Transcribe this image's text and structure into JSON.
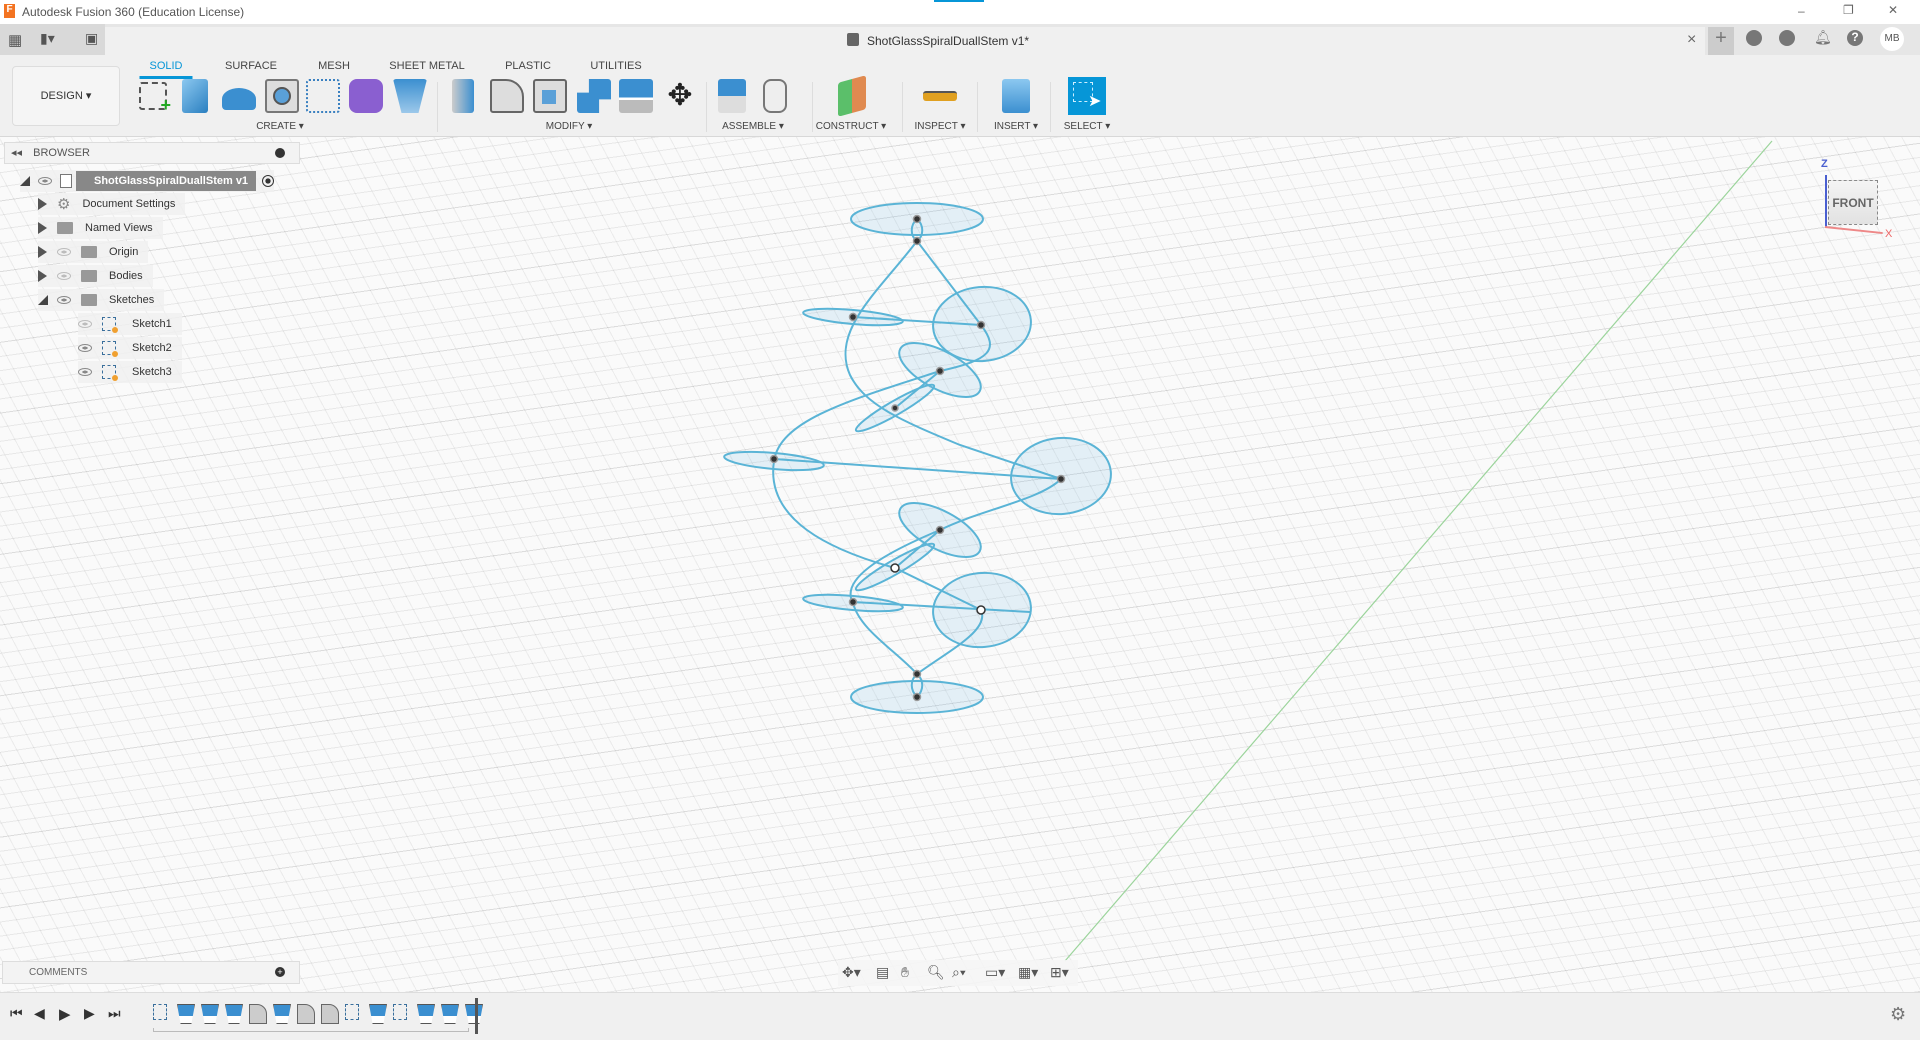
{
  "window": {
    "app_title": "Autodesk Fusion 360 (Education License)",
    "minimize": "–",
    "restore": "❐",
    "close": "✕"
  },
  "tabbar": {
    "document_title": "ShotGlassSpiralDuallStem v1*",
    "close": "×",
    "new_tab": "+",
    "user_initials": "MB"
  },
  "workspace": {
    "label": "DESIGN ▾"
  },
  "tabs": [
    {
      "label": "SOLID",
      "active": true
    },
    {
      "label": "SURFACE"
    },
    {
      "label": "MESH"
    },
    {
      "label": "SHEET METAL"
    },
    {
      "label": "PLASTIC"
    },
    {
      "label": "UTILITIES"
    }
  ],
  "groups": {
    "create": "CREATE ▾",
    "modify": "MODIFY ▾",
    "assemble": "ASSEMBLE ▾",
    "construct": "CONSTRUCT ▾",
    "inspect": "INSPECT ▾",
    "insert": "INSERT ▾",
    "select": "SELECT ▾"
  },
  "tools": {
    "create": [
      "create-sketch",
      "extrude",
      "revolve",
      "hole",
      "pattern",
      "create-form",
      "loft"
    ],
    "modify": [
      "press-pull",
      "fillet",
      "shell",
      "combine",
      "offset-face",
      "move"
    ],
    "assemble": [
      "new-component",
      "joint"
    ],
    "construct": [
      "offset-plane"
    ],
    "inspect": [
      "measure"
    ],
    "insert": [
      "insert-image"
    ],
    "select": [
      "select-window"
    ]
  },
  "browser": {
    "title": "BROWSER",
    "root": "ShotGlassSpiralDuallStem v1",
    "items": [
      {
        "label": "Document Settings",
        "icon": "gear"
      },
      {
        "label": "Named Views",
        "icon": "folder"
      },
      {
        "label": "Origin",
        "icon": "folder",
        "visible": false
      },
      {
        "label": "Bodies",
        "icon": "folder",
        "visible": false
      },
      {
        "label": "Sketches",
        "icon": "folder",
        "visible": true,
        "expanded": true
      }
    ],
    "sketches": [
      {
        "label": "Sketch1",
        "visible": false
      },
      {
        "label": "Sketch2",
        "visible": true
      },
      {
        "label": "Sketch3",
        "visible": true
      }
    ]
  },
  "viewcube": {
    "face": "FRONT",
    "z": "Z",
    "x": "X"
  },
  "comments": {
    "title": "COMMENTS"
  },
  "timeline": {
    "features": [
      "sketch",
      "loft",
      "loft",
      "loft",
      "fillet",
      "loft",
      "fillet",
      "fillet",
      "sketch",
      "loft",
      "sketch",
      "loft",
      "loft",
      "loft"
    ]
  },
  "colors": {
    "accent": "#0696d7",
    "sketch": "#5ab4d6"
  }
}
